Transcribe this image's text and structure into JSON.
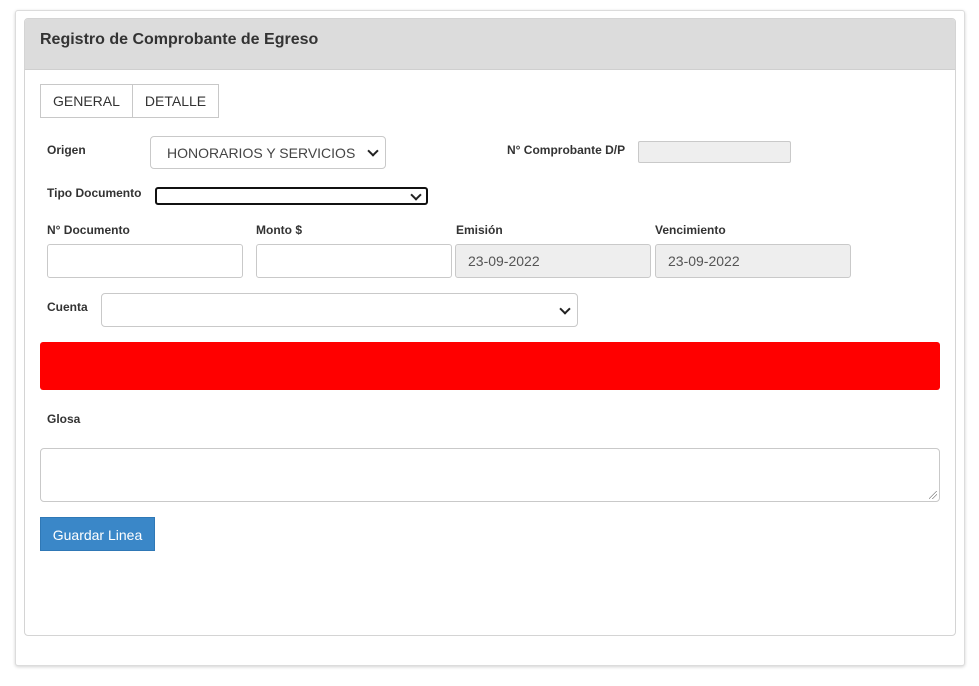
{
  "panel": {
    "title": "Registro de Comprobante de Egreso"
  },
  "tabs": [
    {
      "label": "GENERAL"
    },
    {
      "label": "DETALLE"
    }
  ],
  "form": {
    "origen": {
      "label": "Origen",
      "value": "HONORARIOS Y SERVICIOS"
    },
    "comprobante": {
      "label": "N° Comprobante D/P",
      "value": ""
    },
    "tipo_documento": {
      "label": "Tipo Documento",
      "value": ""
    },
    "nro_documento": {
      "label": "N° Documento",
      "value": ""
    },
    "monto": {
      "label": "Monto $",
      "value": ""
    },
    "emision": {
      "label": "Emisión",
      "value": "23-09-2022"
    },
    "vencimiento": {
      "label": "Vencimiento",
      "value": "23-09-2022"
    },
    "cuenta": {
      "label": "Cuenta",
      "value": ""
    },
    "glosa": {
      "label": "Glosa",
      "value": ""
    }
  },
  "alert": {
    "color": "#ff0000"
  },
  "actions": {
    "save_label": "Guardar Linea"
  }
}
